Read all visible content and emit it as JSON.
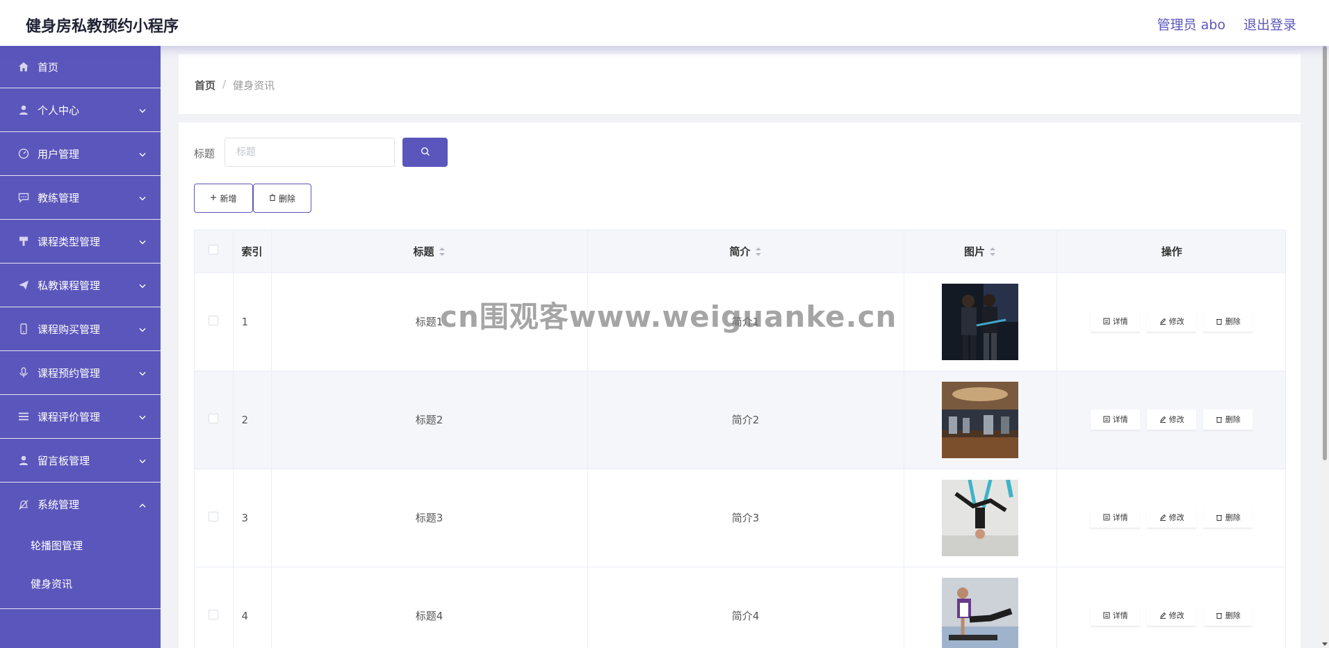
{
  "header": {
    "title": "健身房私教预约小程序",
    "user_label": "管理员 abo",
    "logout_label": "退出登录"
  },
  "sidebar": {
    "items": [
      {
        "label": "首页",
        "icon": "home-icon"
      },
      {
        "label": "个人中心",
        "icon": "user-icon"
      },
      {
        "label": "用户管理",
        "icon": "gauge-icon"
      },
      {
        "label": "教练管理",
        "icon": "chat-icon"
      },
      {
        "label": "课程类型管理",
        "icon": "brush-icon"
      },
      {
        "label": "私教课程管理",
        "icon": "paper-plane-icon"
      },
      {
        "label": "课程购买管理",
        "icon": "phone-icon"
      },
      {
        "label": "课程预约管理",
        "icon": "microphone-icon"
      },
      {
        "label": "课程评价管理",
        "icon": "list-icon"
      },
      {
        "label": "留言板管理",
        "icon": "user-icon"
      },
      {
        "label": "系统管理",
        "icon": "bell-off-icon"
      }
    ],
    "submenu": [
      {
        "label": "轮播图管理"
      },
      {
        "label": "健身资讯"
      }
    ]
  },
  "breadcrumb": {
    "home": "首页",
    "separator": "/",
    "current": "健身资讯"
  },
  "search": {
    "label": "标题",
    "placeholder": "标题"
  },
  "toolbar": {
    "add_label": "新增",
    "delete_label": "删除"
  },
  "table": {
    "columns": {
      "index": "索引",
      "title": "标题",
      "summary": "简介",
      "image": "图片",
      "actions": "操作"
    },
    "rows": [
      {
        "index": "1",
        "title": "标题1",
        "summary": "简介1",
        "image": "trainer-couple-gym-photo"
      },
      {
        "index": "2",
        "title": "标题2",
        "summary": "简介2",
        "image": "gym-interior-photo"
      },
      {
        "index": "3",
        "title": "标题3",
        "summary": "简介3",
        "image": "aerial-yoga-photo"
      },
      {
        "index": "4",
        "title": "标题4",
        "summary": "简介4",
        "image": "floor-exercise-photo"
      }
    ],
    "actions": {
      "detail": "详情",
      "edit": "修改",
      "delete": "删除"
    }
  },
  "watermark": "cn围观客www.weiguanke.cn",
  "colors": {
    "accent": "#5b56bb",
    "header_bg": "#ffffff",
    "page_bg": "#f1f2f6",
    "table_header_bg": "#f5f6fa"
  }
}
